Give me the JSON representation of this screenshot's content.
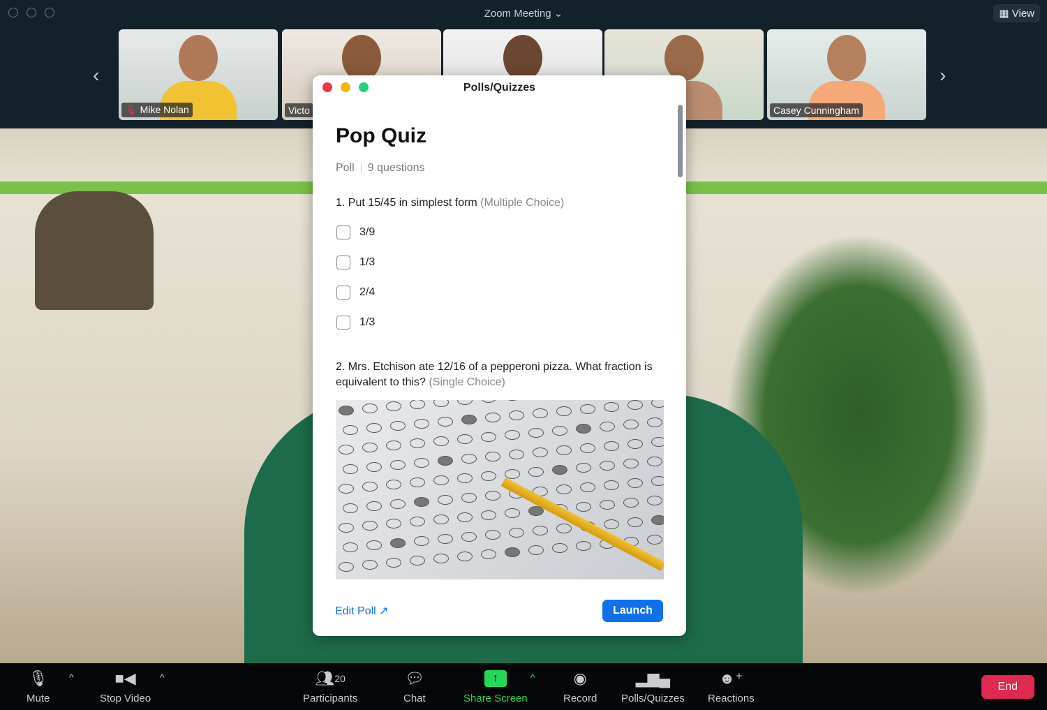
{
  "window": {
    "title": "Zoom Meeting",
    "title_icon": "chevron-down-icon",
    "view_label": "View"
  },
  "participants_strip": [
    {
      "name": "Mike Nolan",
      "muted": true,
      "shirt": "#f1c232"
    },
    {
      "name": "Victo",
      "shirt": "#e0e0e0"
    },
    {
      "name": "",
      "shirt": "#444"
    },
    {
      "name": "",
      "shirt": "#bb8c70"
    },
    {
      "name": "Casey Cunningham",
      "shirt": "#f5a878"
    }
  ],
  "modal": {
    "title": "Polls/Quizzes",
    "quiz_title": "Pop Quiz",
    "type": "Poll",
    "count": "9 questions",
    "questions": [
      {
        "text": "1. Put 15/45 in simplest form",
        "type": "(Multiple Choice)",
        "options": [
          "3/9",
          "1/3",
          "2/4",
          "1/3"
        ]
      },
      {
        "text": "2. Mrs. Etchison ate 12/16 of a pepperoni pizza. What fraction is equivalent to this?",
        "type": "(Single Choice)"
      }
    ],
    "edit_label": "Edit Poll",
    "launch_label": "Launch"
  },
  "toolbar": {
    "mute": "Mute",
    "stop_video": "Stop Video",
    "participants": "Participants",
    "participant_count": "20",
    "chat": "Chat",
    "share_screen": "Share Screen",
    "record": "Record",
    "polls": "Polls/Quizzes",
    "reactions": "Reactions",
    "end": "End"
  },
  "colors": {
    "accent": "#0e71eb",
    "share": "#23d959",
    "end": "#e02851"
  }
}
